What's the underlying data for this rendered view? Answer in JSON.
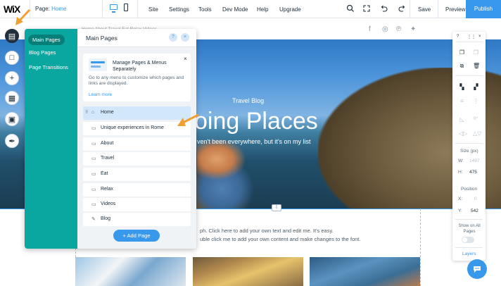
{
  "topbar": {
    "logo": "WiX",
    "page_prefix": "Page:",
    "page_name": "Home",
    "menu": [
      "Site",
      "Settings",
      "Tools",
      "Dev Mode",
      "Help",
      "Upgrade"
    ],
    "save": "Save",
    "preview": "Preview",
    "publish": "Publish"
  },
  "site": {
    "header_nav": "Home   About   Travel   Eat   Relax   Videos",
    "hero_kicker": "Travel Blog",
    "hero_title": "oing Places",
    "hero_subtitle": "ven't been everywhere, but it's on my list",
    "para1": "ph. Click here to add your own text and edit me. It's easy.",
    "para2": "uble click me to add your own content and make changes to the font."
  },
  "pages_panel": {
    "nav": [
      "Main Pages",
      "Blog Pages",
      "Page Transitions"
    ],
    "title": "Main Pages",
    "help_icon": "?",
    "close_icon": "×",
    "tip": {
      "title": "Manage Pages & Menus Separately",
      "body": "Go to any menu to customize which pages and links are displayed.",
      "link": "Learn more",
      "close": "×"
    },
    "pages": [
      {
        "label": "Home",
        "icon": "home-icon"
      },
      {
        "label": "Unique experiences in Rome",
        "icon": "page-icon"
      },
      {
        "label": "About",
        "icon": "page-icon"
      },
      {
        "label": "Travel",
        "icon": "page-icon"
      },
      {
        "label": "Eat",
        "icon": "page-icon"
      },
      {
        "label": "Relax",
        "icon": "page-icon"
      },
      {
        "label": "Videos",
        "icon": "page-icon"
      },
      {
        "label": "Blog",
        "icon": "blog-icon"
      }
    ],
    "add_page": "+ Add Page"
  },
  "inspector": {
    "help": "?",
    "close": "×",
    "size_label": "Size (px)",
    "w_label": "W:",
    "w_value": "1497",
    "h_label": "H:",
    "h_value": "475",
    "position_label": "Position",
    "x_label": "X:",
    "x_value": "0",
    "y_label": "Y:",
    "y_value": "542",
    "rotation_value": "0°",
    "show_all_pages": "Show on All Pages",
    "layers": "Layers"
  },
  "colors": {
    "accent": "#3899ec",
    "panel_nav": "#0aa7a0",
    "arrow": "#f0a030"
  }
}
